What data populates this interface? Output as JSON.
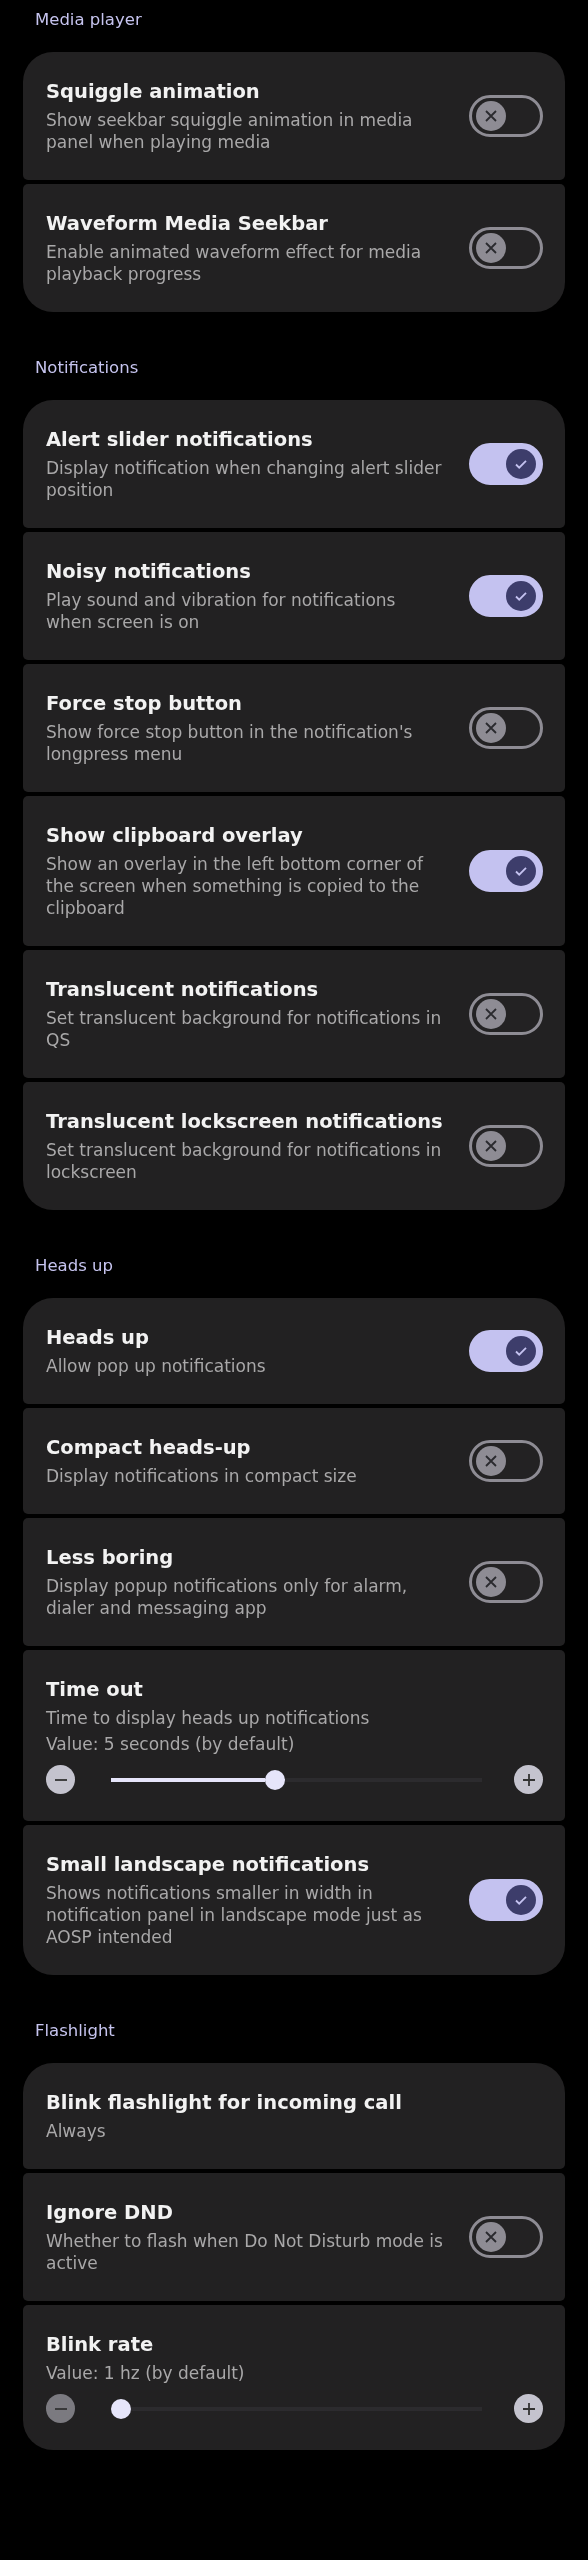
{
  "sections": [
    {
      "title": "Media player",
      "items": [
        {
          "kind": "toggle",
          "title": "Squiggle animation",
          "summary": "Show seekbar squiggle animation in media panel when playing media",
          "on": false
        },
        {
          "kind": "toggle",
          "title": "Waveform Media Seekbar",
          "summary": "Enable animated waveform effect for media playback progress",
          "on": false
        }
      ]
    },
    {
      "title": "Notifications",
      "items": [
        {
          "kind": "toggle",
          "title": "Alert slider notifications",
          "summary": "Display notification when changing alert slider position",
          "on": true
        },
        {
          "kind": "toggle",
          "title": "Noisy notifications",
          "summary": "Play sound and vibration for notifications when screen is on",
          "on": true
        },
        {
          "kind": "toggle",
          "title": "Force stop button",
          "summary": "Show force stop button in the notification's longpress menu",
          "on": false
        },
        {
          "kind": "toggle",
          "title": "Show clipboard overlay",
          "summary": "Show an overlay in the left bottom corner of the screen when something is copied to the clipboard",
          "on": true
        },
        {
          "kind": "toggle",
          "title": "Translucent notifications",
          "summary": "Set translucent background for notifications in QS",
          "on": false
        },
        {
          "kind": "toggle",
          "title": "Translucent lockscreen notifications",
          "summary": "Set translucent background for notifications in lockscreen",
          "on": false
        }
      ]
    },
    {
      "title": "Heads up",
      "items": [
        {
          "kind": "toggle",
          "title": "Heads up",
          "summary": "Allow pop up notifications",
          "on": true
        },
        {
          "kind": "toggle",
          "title": "Compact heads-up",
          "summary": "Display notifications in compact size",
          "on": false
        },
        {
          "kind": "toggle",
          "title": "Less boring",
          "summary": "Display popup notifications only for alarm, dialer and messaging app",
          "on": false
        },
        {
          "kind": "slider",
          "title": "Time out",
          "summary": "Time to display heads up notifications",
          "value": "Value: 5 seconds (by default)",
          "level": 0.44,
          "minus_disabled": false
        },
        {
          "kind": "toggle",
          "title": "Small landscape notifications",
          "summary": "Shows notifications smaller in width in notification panel in landscape mode just as AOSP intended",
          "on": true
        }
      ]
    },
    {
      "title": "Flashlight",
      "items": [
        {
          "kind": "plain",
          "title": "Blink flashlight for incoming call",
          "summary": "Always"
        },
        {
          "kind": "toggle",
          "title": "Ignore DND",
          "summary": "Whether to flash when Do Not Disturb mode is active",
          "on": false
        },
        {
          "kind": "slider",
          "title": "Blink rate",
          "value": "Value: 1 hz (by default)",
          "level": 0,
          "minus_disabled": true
        }
      ]
    }
  ]
}
